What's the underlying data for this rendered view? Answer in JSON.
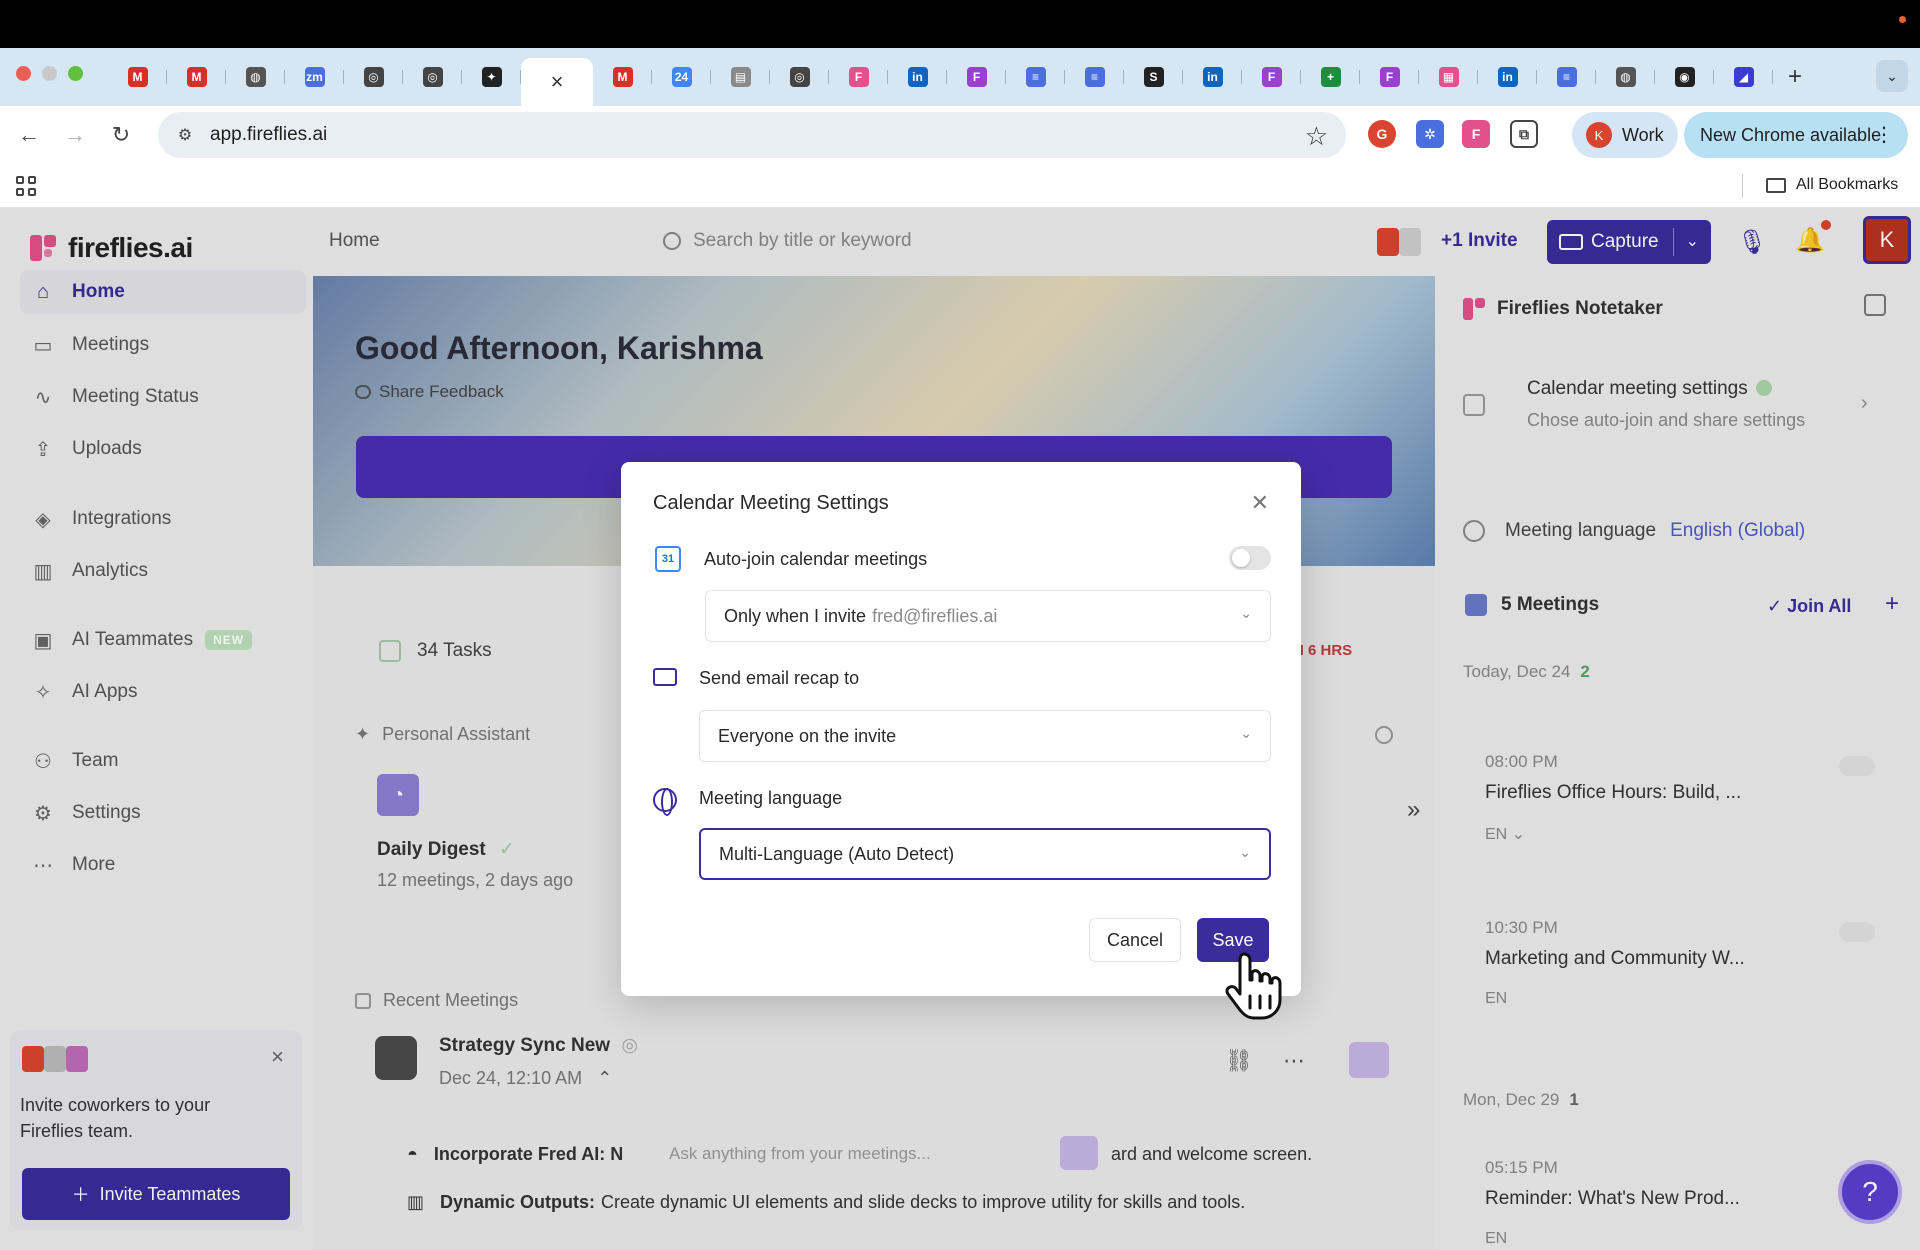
{
  "browser": {
    "tabs": [
      {
        "icon": "gmail-icon",
        "letter": "M",
        "color": "#d93025"
      },
      {
        "icon": "gmail-icon",
        "letter": "M",
        "color": "#d93025"
      },
      {
        "icon": "globe-icon",
        "letter": "◍",
        "color": "#555555"
      },
      {
        "icon": "zoom-icon",
        "letter": "zm",
        "color": "#4a6ee0"
      },
      {
        "icon": "openai-icon",
        "letter": "◎",
        "color": "#444444"
      },
      {
        "icon": "openai-icon",
        "letter": "◎",
        "color": "#444444"
      },
      {
        "icon": "sparkle-icon",
        "letter": "✦",
        "color": "#222222"
      },
      {
        "icon": "gmail-icon",
        "letter": "M",
        "color": "#d93025"
      },
      {
        "icon": "calendar-icon",
        "letter": "24",
        "color": "#4285f4"
      },
      {
        "icon": "docs-icon",
        "letter": "▤",
        "color": "#8a8a8a"
      },
      {
        "icon": "openai-icon",
        "letter": "◎",
        "color": "#444444"
      },
      {
        "icon": "fireflies-icon",
        "letter": "F",
        "color": "#e3508b"
      },
      {
        "icon": "linkedin-icon",
        "letter": "in",
        "color": "#0a66c2"
      },
      {
        "icon": "fireflies-icon",
        "letter": "F",
        "color": "#9b3fd1"
      },
      {
        "icon": "docs-icon",
        "letter": "≡",
        "color": "#4a6ee0"
      },
      {
        "icon": "docs-icon",
        "letter": "≡",
        "color": "#4a6ee0"
      },
      {
        "icon": "scribd-icon",
        "letter": "S",
        "color": "#222222"
      },
      {
        "icon": "linkedin-icon",
        "letter": "in",
        "color": "#0a66c2"
      },
      {
        "icon": "fireflies-icon",
        "letter": "F",
        "color": "#9b3fd1"
      },
      {
        "icon": "sheets-icon",
        "letter": "+",
        "color": "#1e8e3e"
      },
      {
        "icon": "fireflies-icon",
        "letter": "F",
        "color": "#9b3fd1"
      },
      {
        "icon": "calendar-icon",
        "letter": "▦",
        "color": "#e3508b"
      },
      {
        "icon": "linkedin-icon",
        "letter": "in",
        "color": "#0a66c2"
      },
      {
        "icon": "docs-icon",
        "letter": "≡",
        "color": "#4a6ee0"
      },
      {
        "icon": "globe-icon",
        "letter": "◍",
        "color": "#555555"
      },
      {
        "icon": "github-icon",
        "letter": "◉",
        "color": "#222222"
      },
      {
        "icon": "linear-icon",
        "letter": "◢",
        "color": "#3b3bd1"
      }
    ],
    "active_tab_close": "×",
    "new_tab": "+",
    "url": "app.fireflies.ai",
    "profile_initial": "K",
    "profile_name": "Work",
    "update_label": "New Chrome available",
    "bookmarks_label": "All Bookmarks"
  },
  "app": {
    "logo": "fireflies.ai",
    "nav": [
      {
        "label": "Home",
        "icon": "home-icon",
        "glyph": "⌂"
      },
      {
        "label": "Meetings",
        "icon": "video-icon",
        "glyph": "▭"
      },
      {
        "label": "Meeting Status",
        "icon": "pulse-icon",
        "glyph": "∿"
      },
      {
        "label": "Uploads",
        "icon": "upload-icon",
        "glyph": "⇪"
      },
      {
        "label": "Integrations",
        "icon": "layers-icon",
        "glyph": "◈"
      },
      {
        "label": "Analytics",
        "icon": "bar-chart-icon",
        "glyph": "▥"
      },
      {
        "label": "AI Teammates",
        "icon": "robot-icon",
        "glyph": "▣",
        "badge": "NEW"
      },
      {
        "label": "AI Apps",
        "icon": "sparkle-icon",
        "glyph": "✧"
      },
      {
        "label": "Team",
        "icon": "team-icon",
        "glyph": "⚇"
      },
      {
        "label": "Settings",
        "icon": "gear-icon",
        "glyph": "⚙"
      },
      {
        "label": "More",
        "icon": "more-icon",
        "glyph": "⋯"
      }
    ],
    "invite_card": {
      "text": "Invite coworkers to your Fireflies team.",
      "button": "Invite Teammates"
    },
    "topbar": {
      "breadcrumb": "Home",
      "search_placeholder": "Search by title or keyword",
      "invite": "+1  Invite",
      "capture": "Capture",
      "avatar": "K"
    },
    "main": {
      "greeting": "Good Afternoon, Karishma",
      "feedback": "Share Feedback",
      "tasks": "34 Tasks",
      "hrs": "N 6 HRS",
      "personal_assistant": "Personal Assistant",
      "digest_title": "Daily Digest",
      "digest_sub": "12 meetings, 2 days ago",
      "recent_meetings": "Recent Meetings",
      "meeting_title": "Strategy Sync New",
      "meeting_date": "Dec 24, 12:10 AM",
      "row1_label": "Incorporate Fred AI: N",
      "ask_placeholder": "Ask anything from your meetings...",
      "row1_tail": "ard and welcome screen.",
      "row2_label": "Dynamic Outputs:",
      "row2_text": "Create dynamic UI elements and slide decks to improve utility for skills and tools."
    },
    "right_panel": {
      "title": "Fireflies Notetaker",
      "settings_title": "Calendar meeting settings",
      "settings_sub": "Chose auto-join and share settings",
      "lang_label": "Meeting language",
      "lang_value": "English (Global)",
      "meetings_count": "5 Meetings",
      "join_all": "✓ Join All",
      "day1": "Today, Dec 24",
      "day1_count": "2",
      "events": [
        {
          "time": "08:00 PM",
          "title": "Fireflies Office Hours: Build, ...",
          "lang": "EN ⌄"
        },
        {
          "time": "10:30 PM",
          "title": "Marketing and Community W...",
          "lang": "EN"
        }
      ],
      "day2": "Mon, Dec 29",
      "day2_count": "1",
      "event3_time": "05:15 PM",
      "event3_title": "Reminder: What's New Prod...",
      "event3_lang": "EN"
    }
  },
  "modal": {
    "title": "Calendar Meeting Settings",
    "autojoin_label": "Auto-join calendar meetings",
    "autojoin_select": "Only when I invite",
    "autojoin_email": "fred@fireflies.ai",
    "recap_label": "Send email recap to",
    "recap_select": "Everyone on the invite",
    "language_label": "Meeting language",
    "language_select": "Multi-Language (Auto Detect)",
    "cancel": "Cancel",
    "save": "Save",
    "gcal_day": "31"
  },
  "colors": {
    "brand": "#3b2c9e",
    "accent_pink": "#e3508b"
  }
}
